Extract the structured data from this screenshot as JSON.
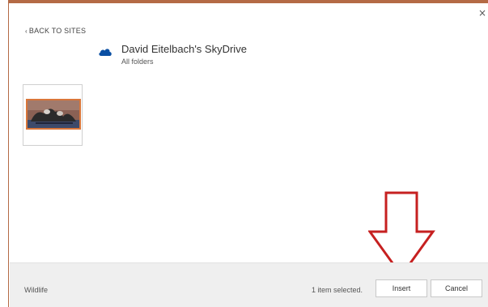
{
  "dialog": {
    "close_glyph": "×",
    "back_link": {
      "chevron": "‹",
      "label": "BACK TO SITES"
    },
    "location": {
      "title": "David Eitelbach's SkyDrive",
      "subtitle": "All folders",
      "icon": "skydrive-cloud-icon"
    },
    "thumbnail": {
      "icon": "wildlife-photo",
      "selected": true
    },
    "footer": {
      "file_name": "Wildlife",
      "status": "1 item selected.",
      "insert_label": "Insert",
      "cancel_label": "Cancel"
    },
    "annotation": {
      "icon": "down-arrow-icon"
    },
    "colors": {
      "frame": "#b46a45",
      "cloud": "#0a4fa3",
      "arrow": "#c62020",
      "thumb_border": "#d9763a",
      "footer_bg": "#efefef"
    }
  }
}
